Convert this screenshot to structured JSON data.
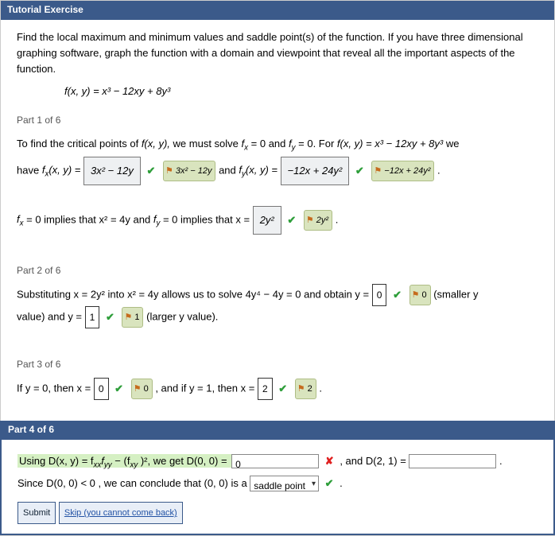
{
  "header": {
    "title": "Tutorial Exercise"
  },
  "prompt": {
    "text": "Find the local maximum and minimum values and saddle point(s) of the function. If you have three dimensional graphing software, graph the function with a domain and viewpoint that reveal all the important aspects of the function.",
    "equation": "f(x, y) = x³ − 12xy + 8y³"
  },
  "part1": {
    "label": "Part 1 of 6",
    "line1_a": "To find the critical points of ",
    "line1_b": "f(x, y),",
    "line1_c": " we must solve ",
    "line1_d": " = 0 and ",
    "line1_e": " = 0.  For ",
    "line1_f": "f(x, y) = x³ − 12xy + 8y³",
    "line1_g": " we",
    "line2_a": "have ",
    "box1": "3x² − 12y",
    "tag1": "3x² − 12y",
    "line2_b": " and ",
    "box2": "−12x + 24y²",
    "tag2": "−12x + 24y²",
    "period": ".",
    "line3_a": " = 0  implies that  x² = 4y  and ",
    "line3_b": " = 0  implies that x = ",
    "box3": "2y²",
    "tag3": "2y²",
    "tail": "."
  },
  "part2": {
    "label": "Part 2 of 6",
    "line_a": "Substituting  x = 2y²  into  x² = 4y  allows us to solve  4y⁴ − 4y = 0  and obtain y = ",
    "val0": "0",
    "tag0": "0",
    "paren0": "  (smaller y",
    "line_b": "value) and y = ",
    "val1": "1",
    "tag1": "1",
    "paren1": "  (larger y value)."
  },
  "part3": {
    "label": "Part 3 of 6",
    "line_a": "If y = 0, then x = ",
    "val0": "0",
    "tag0": "0",
    "line_b": " ,  and if y = 1, then x = ",
    "val1": "2",
    "tag1": "2",
    "tail": " ."
  },
  "part4": {
    "label": "Part 4 of 6",
    "hl_a": "Using  D(x, y) = f",
    "hl_b": " − (f",
    "hl_c": ")²,  we get  D(0, 0) = ",
    "input0": "0",
    "mid": " ,   and  D(2, 1) = ",
    "input1": "",
    "after": " .",
    "line2_a": "Since  D(0, 0) < 0  ,  we can conclude that  (0, 0)  is a ",
    "select": "saddle point",
    "line2_b": "   .",
    "submit": "Submit",
    "skip": "Skip (you cannot come back)"
  },
  "glyphs": {
    "check": "✔",
    "cross": "✘",
    "flag": "⚑"
  }
}
